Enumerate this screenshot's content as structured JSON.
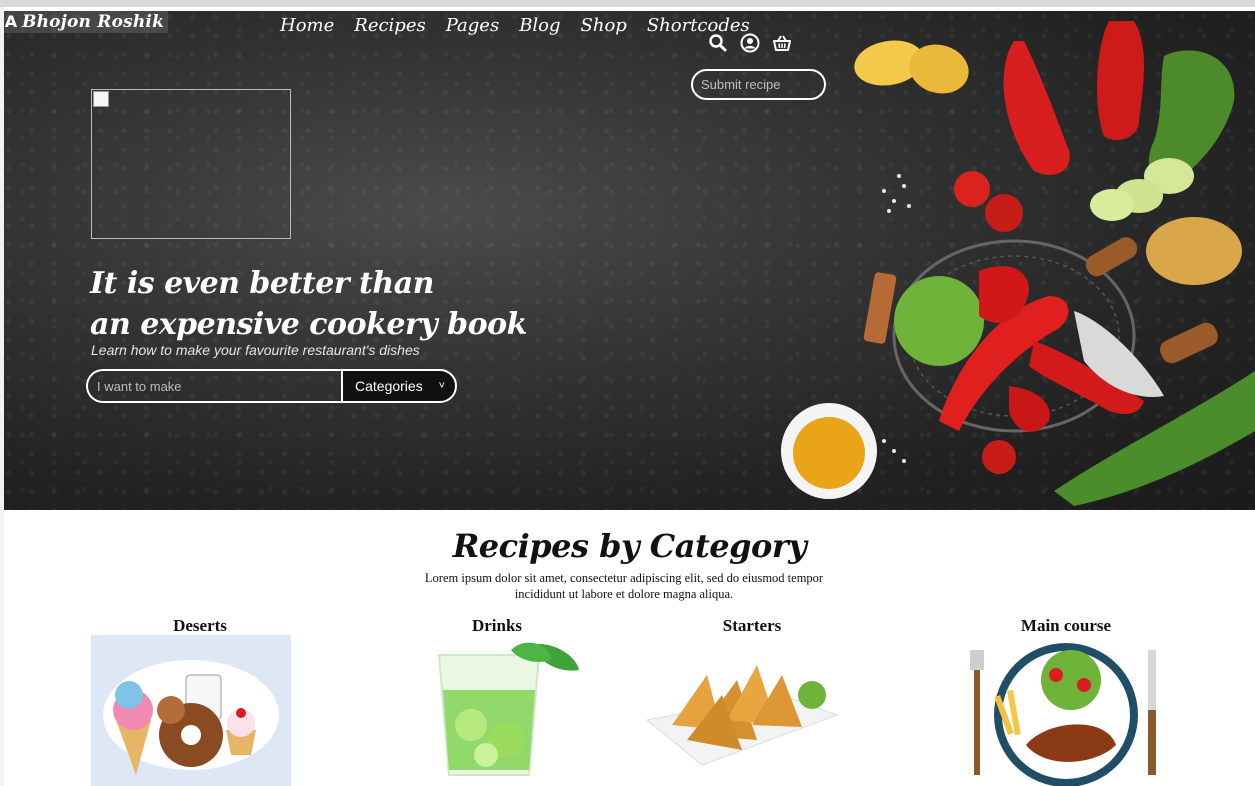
{
  "brand": {
    "name": "Bhojon Roshik",
    "icon": "logo-icon"
  },
  "nav": {
    "items": [
      "Home",
      "Recipes",
      "Pages",
      "Blog",
      "Shop",
      "Shortcodes"
    ]
  },
  "header_icons": [
    "search-icon",
    "user-circle-icon",
    "basket-icon"
  ],
  "submit_recipe": {
    "placeholder": "Submit recipe"
  },
  "hero": {
    "title_line1": "It is even better than",
    "title_line2": "an expensive cookery book",
    "subtitle": "Learn how to make your favourite restaurant's dishes",
    "search_placeholder": "I want to make",
    "select_label": "Categories"
  },
  "categories_section": {
    "title": "Recipes by Category",
    "description": "Lorem ipsum dolor sit amet, consectetur adipiscing elit, sed do eiusmod tempor incididunt ut labore et dolore magna aliqua.",
    "items": [
      {
        "label": "Deserts"
      },
      {
        "label": "Drinks"
      },
      {
        "label": "Starters"
      },
      {
        "label": "Main course"
      }
    ]
  },
  "colors": {
    "hero_bg": "#2e2e2e",
    "text_on_hero": "#ffffff",
    "accent_red": "#d81e1e"
  }
}
